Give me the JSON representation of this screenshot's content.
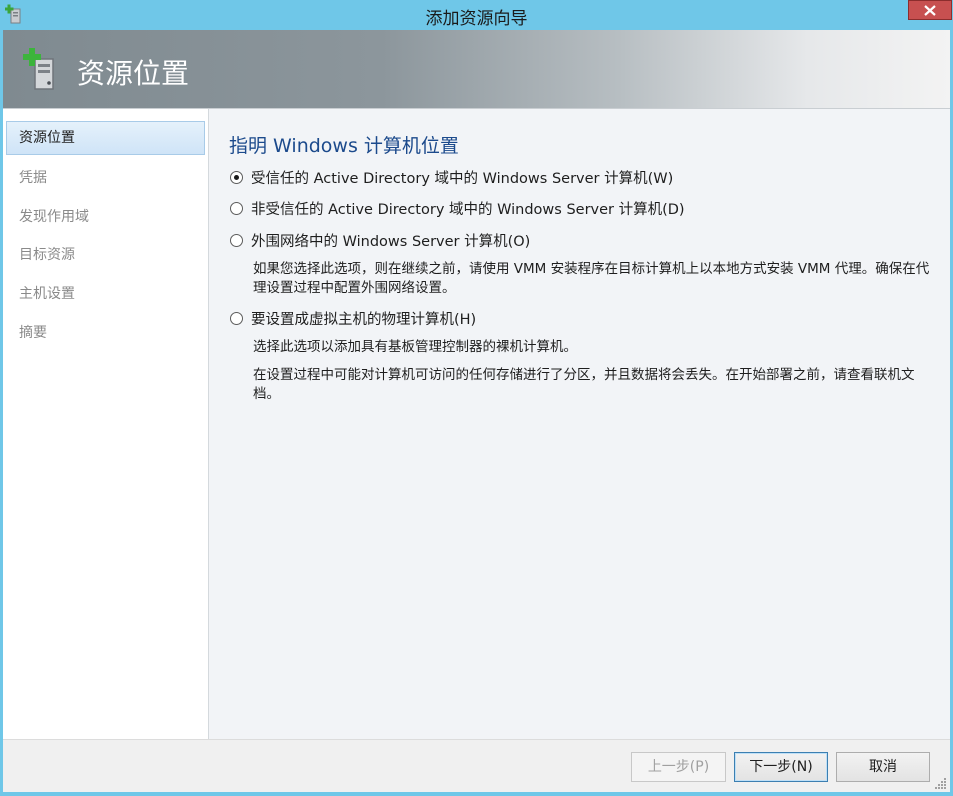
{
  "window": {
    "title": "添加资源向导",
    "icon": "add-server-icon",
    "close_icon": "close-icon",
    "close_color": "#c75050"
  },
  "header": {
    "title": "资源位置",
    "icon": "add-server-icon"
  },
  "sidebar": {
    "items": [
      {
        "label": "资源位置",
        "selected": true
      },
      {
        "label": "凭据",
        "selected": false
      },
      {
        "label": "发现作用域",
        "selected": false
      },
      {
        "label": "目标资源",
        "selected": false
      },
      {
        "label": "主机设置",
        "selected": false
      },
      {
        "label": "摘要",
        "selected": false
      }
    ]
  },
  "main": {
    "title": "指明 Windows 计算机位置",
    "options": [
      {
        "label": "受信任的 Active Directory 域中的 Windows Server 计算机(W)",
        "checked": true
      },
      {
        "label": "非受信任的 Active Directory 域中的 Windows Server 计算机(D)",
        "checked": false
      },
      {
        "label": "外围网络中的 Windows Server 计算机(O)",
        "checked": false
      },
      {
        "label": "要设置成虚拟主机的物理计算机(H)",
        "checked": false
      }
    ],
    "perimeter_description": "如果您选择此选项，则在继续之前，请使用 VMM 安装程序在目标计算机上以本地方式安装 VMM 代理。确保在代理设置过程中配置外围网络设置。",
    "physical_description_1": "选择此选项以添加具有基板管理控制器的裸机计算机。",
    "physical_description_2": "在设置过程中可能对计算机可访问的任何存储进行了分区，并且数据将会丢失。在开始部署之前，请查看联机文档。"
  },
  "footer": {
    "previous_label": "上一步(P)",
    "previous_enabled": false,
    "next_label": "下一步(N)",
    "cancel_label": "取消"
  },
  "colors": {
    "titlebar": "#6fc7e8",
    "heading": "#1c4a8c",
    "selection": "#cfe4f7"
  }
}
